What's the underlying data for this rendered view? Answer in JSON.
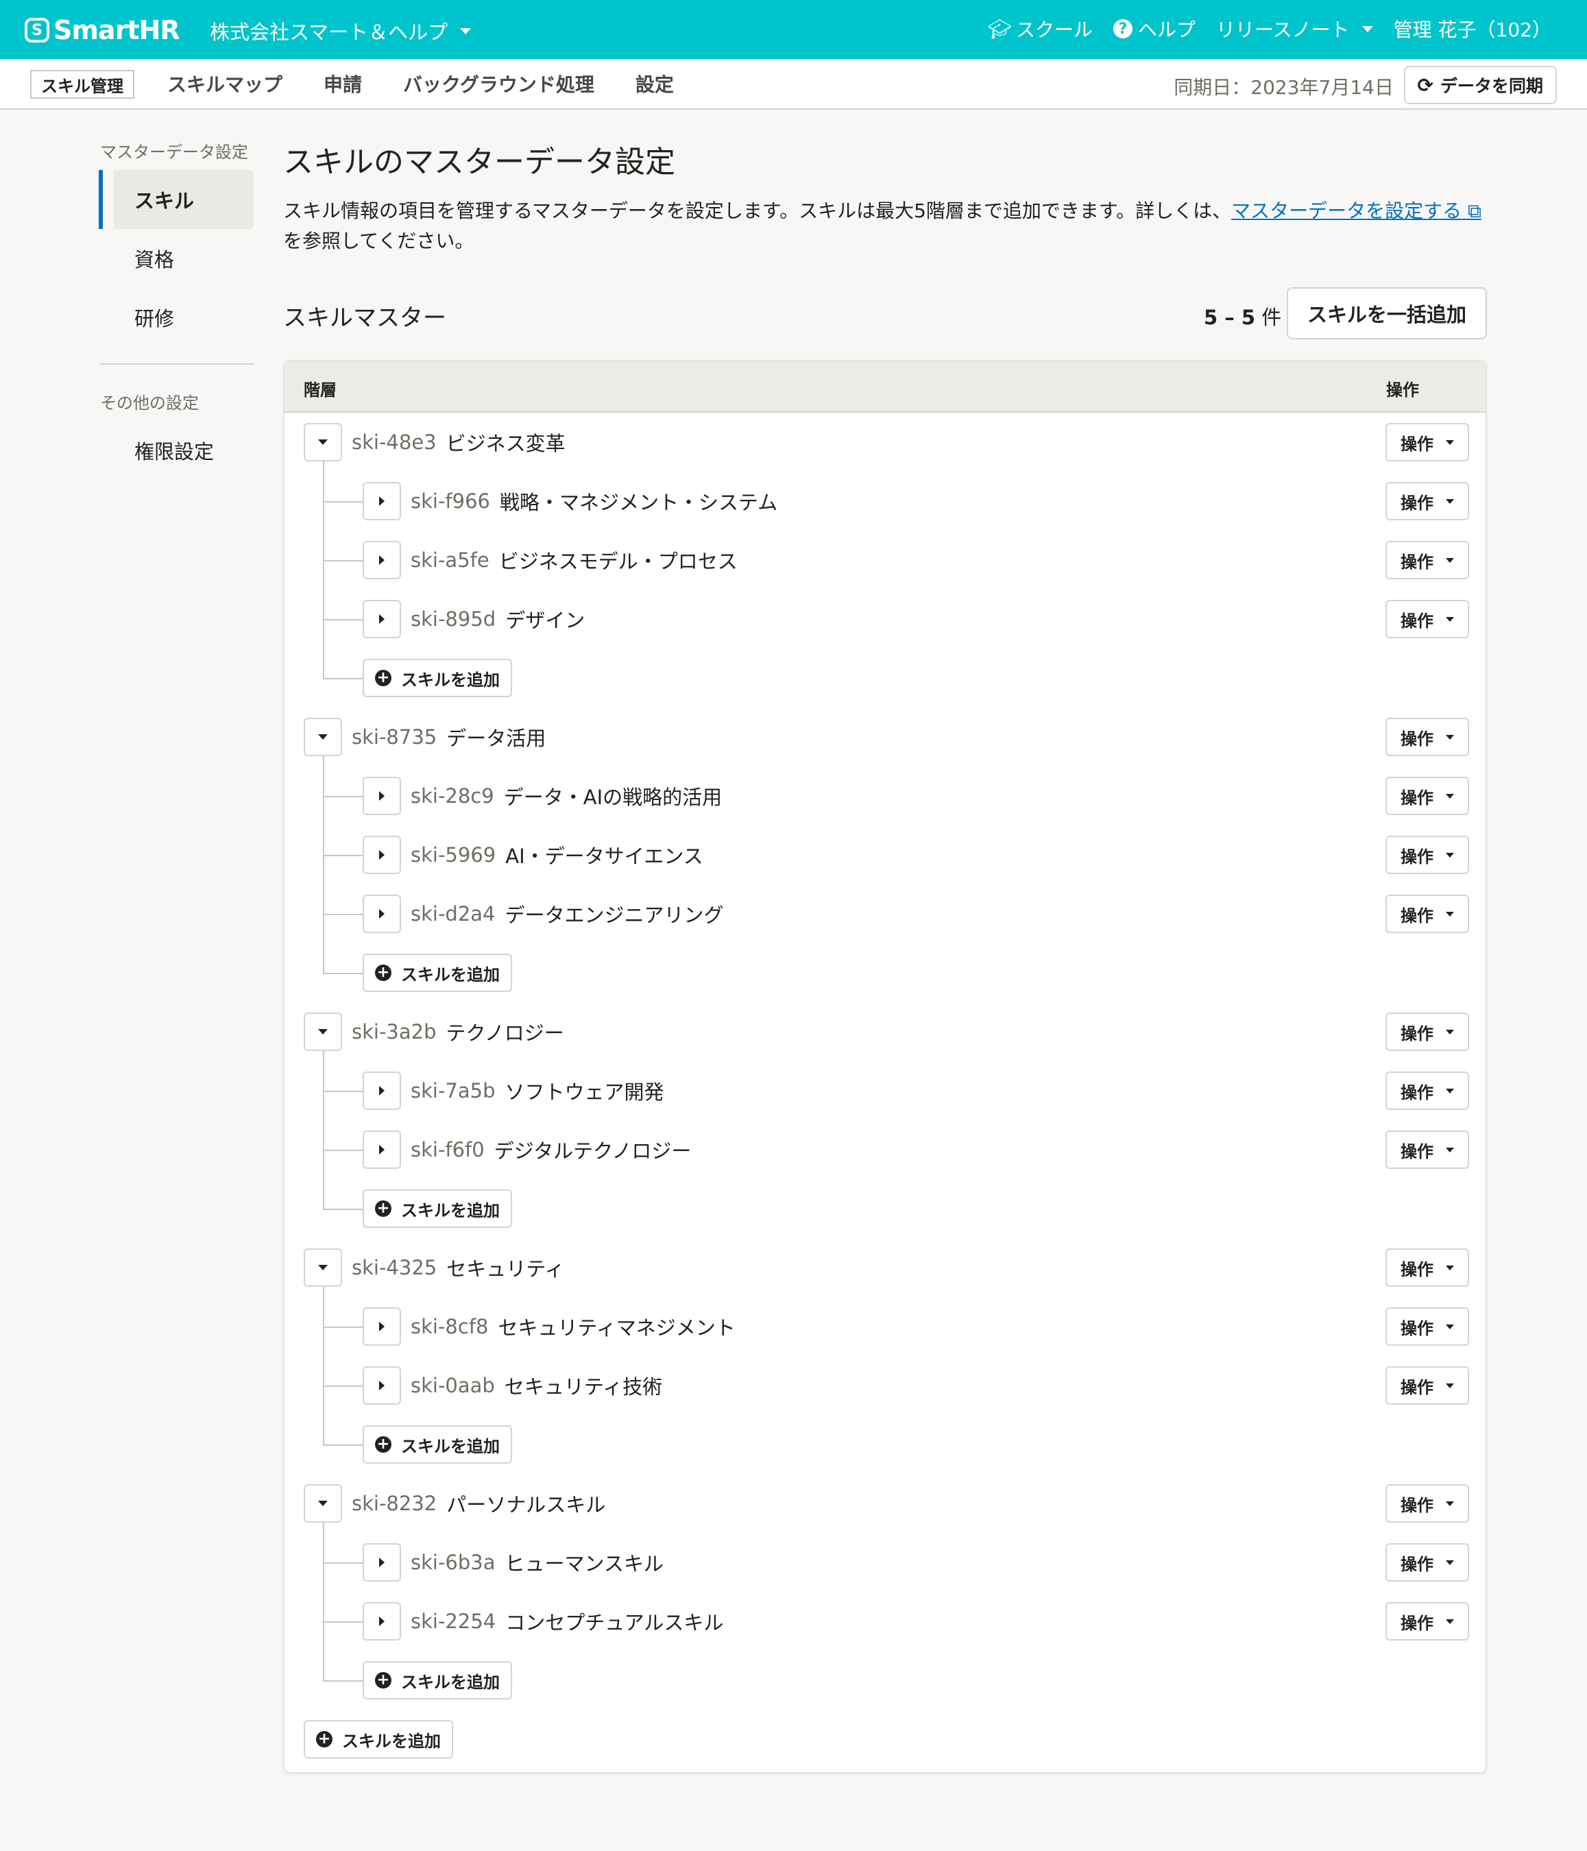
{
  "header": {
    "logo_mark": "S",
    "logo_text": "SmartHR",
    "tenant": "株式会社スマート＆ヘルプ",
    "school": "スクール",
    "help": "ヘルプ",
    "release_notes": "リリースノート",
    "user": "管理 花子（102）"
  },
  "subnav": {
    "app_badge": "スキル管理",
    "tabs": [
      "スキルマップ",
      "申請",
      "バックグラウンド処理",
      "設定"
    ],
    "sync_date": "同期日：2023年7月14日",
    "sync_button": "データを同期"
  },
  "sidebar": {
    "section1": "マスターデータ設定",
    "items1": [
      "スキル",
      "資格",
      "研修"
    ],
    "section2": "その他の設定",
    "items2": [
      "権限設定"
    ]
  },
  "main": {
    "title": "スキルのマスターデータ設定",
    "desc_text": "スキル情報の項目を管理するマスターデータを設定します。スキルは最大5階層まで追加できます。詳しくは、",
    "desc_link": "マスターデータを設定する",
    "desc_tail": " を参照してください。",
    "section_title": "スキルマスター",
    "count_range": "5 – 5",
    "count_unit": " 件",
    "bulk_add": "スキルを一括追加"
  },
  "table": {
    "col_level": "階層",
    "col_op": "操作",
    "op_label": "操作",
    "add_label": "スキルを追加",
    "groups": [
      {
        "id": "ski-48e3",
        "name": "ビジネス変革",
        "children": [
          {
            "id": "ski-f966",
            "name": "戦略・マネジメント・システム"
          },
          {
            "id": "ski-a5fe",
            "name": "ビジネスモデル・プロセス"
          },
          {
            "id": "ski-895d",
            "name": "デザイン"
          }
        ]
      },
      {
        "id": "ski-8735",
        "name": "データ活用",
        "children": [
          {
            "id": "ski-28c9",
            "name": "データ・AIの戦略的活用"
          },
          {
            "id": "ski-5969",
            "name": "AI・データサイエンス"
          },
          {
            "id": "ski-d2a4",
            "name": "データエンジニアリング"
          }
        ]
      },
      {
        "id": "ski-3a2b",
        "name": "テクノロジー",
        "children": [
          {
            "id": "ski-7a5b",
            "name": "ソフトウェア開発"
          },
          {
            "id": "ski-f6f0",
            "name": "デジタルテクノロジー"
          }
        ]
      },
      {
        "id": "ski-4325",
        "name": "セキュリティ",
        "children": [
          {
            "id": "ski-8cf8",
            "name": "セキュリティマネジメント"
          },
          {
            "id": "ski-0aab",
            "name": "セキュリティ技術"
          }
        ]
      },
      {
        "id": "ski-8232",
        "name": "パーソナルスキル",
        "children": [
          {
            "id": "ski-6b3a",
            "name": "ヒューマンスキル"
          },
          {
            "id": "ski-2254",
            "name": "コンセプチュアルスキル"
          }
        ]
      }
    ]
  },
  "colors": {
    "brand": "#00c4cc",
    "link": "#0071c1"
  }
}
